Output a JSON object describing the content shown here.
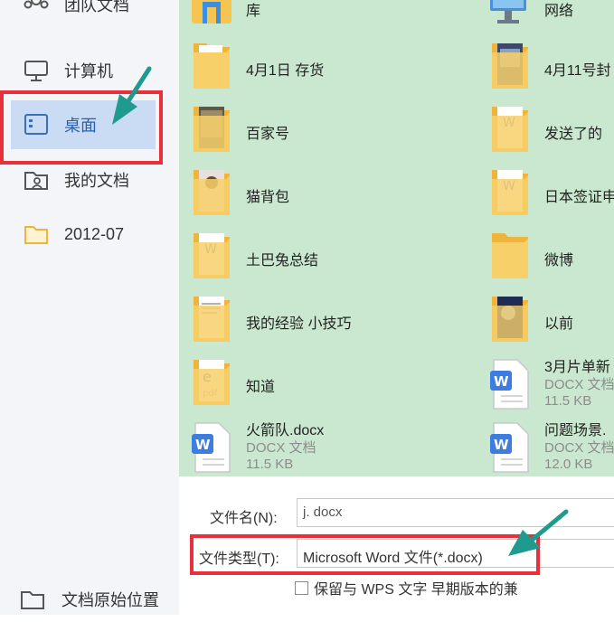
{
  "sidebar": {
    "items": [
      {
        "label": "团队文档"
      },
      {
        "label": "计算机"
      },
      {
        "label": "桌面"
      },
      {
        "label": "我的文档"
      },
      {
        "label": "2012-07"
      }
    ],
    "bottom_label": "文档原始位置"
  },
  "files": [
    {
      "name": "库"
    },
    {
      "name": "网络"
    },
    {
      "name": "4月1日 存货"
    },
    {
      "name": "4月11号封"
    },
    {
      "name": "百家号"
    },
    {
      "name": "发送了的"
    },
    {
      "name": "猫背包"
    },
    {
      "name": "日本签证申"
    },
    {
      "name": "土巴兔总结"
    },
    {
      "name": "微博"
    },
    {
      "name": "我的经验  小技巧"
    },
    {
      "name": "以前"
    },
    {
      "name": "知道"
    },
    {
      "name": "3月片单新",
      "type": "DOCX 文档",
      "size": "11.5 KB"
    },
    {
      "name": "火箭队.docx",
      "type": "DOCX 文档",
      "size": "11.5 KB"
    },
    {
      "name": "问题场景.",
      "type": "DOCX 文档",
      "size": "12.0 KB"
    }
  ],
  "form": {
    "filename_label": "文件名(N):",
    "filename_value": "j. docx",
    "filetype_label": "文件类型(T):",
    "filetype_value": "Microsoft Word 文件(*.docx)",
    "keep_label": "保留与 WPS 文字 早期版本的兼"
  },
  "colors": {
    "grid_bg": "#cae8cf",
    "sidebar_bg": "#f3f5f8",
    "selected_bg": "#c9dcf3",
    "highlight_red": "#e7303a",
    "arrow_teal": "#1f9a8e",
    "folder_yellow": "#f5c451",
    "word_blue": "#3d7ce0"
  }
}
